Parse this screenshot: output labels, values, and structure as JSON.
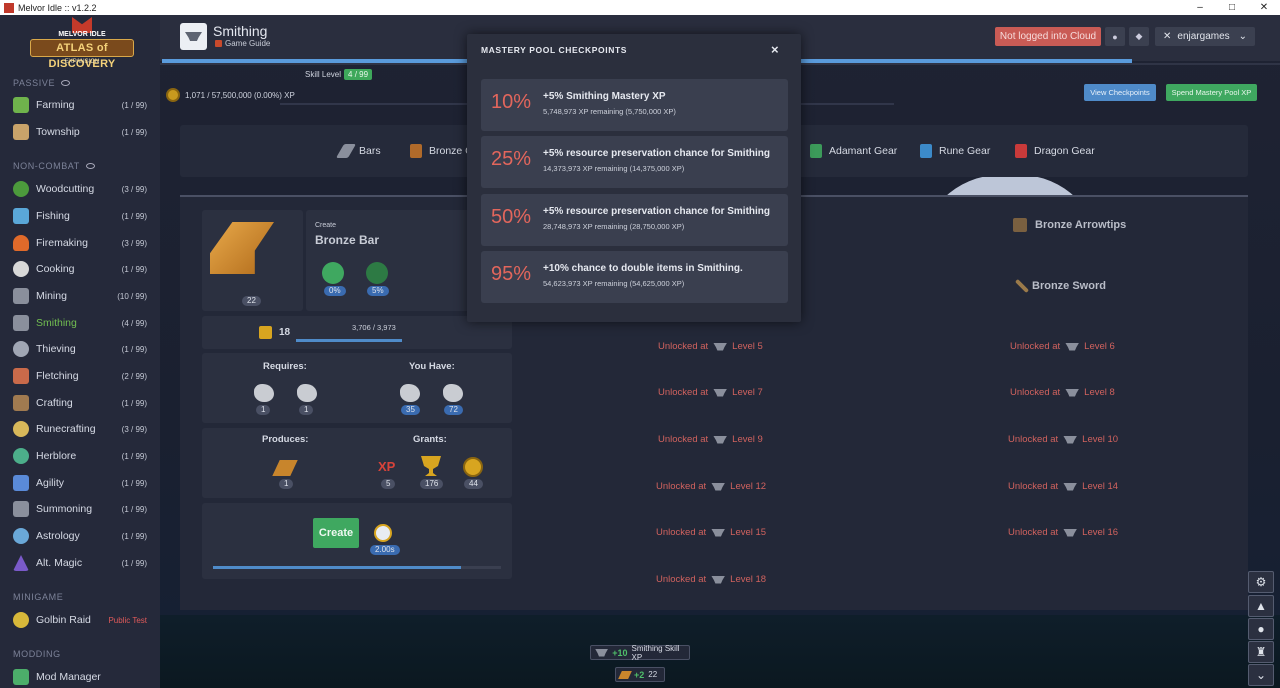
{
  "window": {
    "title": "Melvor Idle :: v1.2.2",
    "controls": [
      "–",
      "□",
      "✕"
    ]
  },
  "logo": {
    "top": "MELVOR IDLE",
    "main": "ATLAS of DISCOVERY",
    "sub": "EXPANSION"
  },
  "sidebar": {
    "sections": [
      {
        "label": "PASSIVE"
      },
      {
        "label": "NON-COMBAT"
      },
      {
        "label": "MINIGAME"
      },
      {
        "label": "MODDING"
      }
    ],
    "items": [
      {
        "label": "Farming",
        "level": "(1 / 99)",
        "color": "#6fb34c"
      },
      {
        "label": "Township",
        "level": "(1 / 99)",
        "color": "#c9a36a"
      },
      {
        "label": "Woodcutting",
        "level": "(3 / 99)",
        "color": "#4c9a3c"
      },
      {
        "label": "Fishing",
        "level": "(1 / 99)",
        "color": "#5aa7d8"
      },
      {
        "label": "Firemaking",
        "level": "(3 / 99)",
        "color": "#e06a2a"
      },
      {
        "label": "Cooking",
        "level": "(1 / 99)",
        "color": "#d8d8d8"
      },
      {
        "label": "Mining",
        "level": "(10 / 99)",
        "color": "#8a8f9c"
      },
      {
        "label": "Smithing",
        "level": "(4 / 99)",
        "color": "#8a8f9c"
      },
      {
        "label": "Thieving",
        "level": "(1 / 99)",
        "color": "#a0a6b4"
      },
      {
        "label": "Fletching",
        "level": "(2 / 99)",
        "color": "#c96a4a"
      },
      {
        "label": "Crafting",
        "level": "(1 / 99)",
        "color": "#a07a50"
      },
      {
        "label": "Runecrafting",
        "level": "(3 / 99)",
        "color": "#d8b85a"
      },
      {
        "label": "Herblore",
        "level": "(1 / 99)",
        "color": "#4cae8a"
      },
      {
        "label": "Agility",
        "level": "(1 / 99)",
        "color": "#5a8ad8"
      },
      {
        "label": "Summoning",
        "level": "(1 / 99)",
        "color": "#8a8f9c"
      },
      {
        "label": "Astrology",
        "level": "(1 / 99)",
        "color": "#6aa8d8"
      },
      {
        "label": "Alt. Magic",
        "level": "(1 / 99)",
        "color": "#7a5ac9"
      }
    ],
    "minigame": {
      "label": "Golbin Raid",
      "badge": "Public Test"
    },
    "modding": {
      "label": "Mod Manager"
    }
  },
  "header": {
    "title": "Smithing",
    "guide": "Game Guide",
    "cloud_btn": "Not logged into Cloud",
    "user": "enjargames",
    "skill_level_label": "Skill Level",
    "skill_level": "4 / 99",
    "mastery_xp": "1,071 / 57,500,000 (0.00%) XP",
    "view_checkpoints": "View Checkpoints",
    "spend_pool": "Spend Mastery Pool XP"
  },
  "categories": [
    "Bars",
    "Bronze Gear",
    "Adamant Gear",
    "Rune Gear",
    "Dragon Gear"
  ],
  "recipe": {
    "create_label": "Create",
    "name": "Bronze Bar",
    "qty": "22",
    "preserve": "0%",
    "double": "5%",
    "mastery_level": "18",
    "mastery_xp": "3,706 / 3,973",
    "mastery_progress": 0.93,
    "requires_label": "Requires:",
    "you_have_label": "You Have:",
    "requires": [
      "1",
      "1"
    ],
    "you_have": [
      "35",
      "72"
    ],
    "produces_label": "Produces:",
    "grants_label": "Grants:",
    "produces": [
      "1"
    ],
    "grants": [
      {
        "icon": "XP",
        "qty": "5"
      },
      {
        "qty": "176"
      },
      {
        "qty": "44"
      }
    ],
    "create_btn": "Create",
    "interval": "2.00s",
    "progress": 0.86
  },
  "recipes_right": [
    "Bronze Arrowtips",
    "Bronze Sword"
  ],
  "unlocks": {
    "prefix": "Unlocked at",
    "left": [
      "Level 5",
      "Level 7",
      "Level 9",
      "Level 12",
      "Level 15",
      "Level 18"
    ],
    "right": [
      "Level 6",
      "Level 8",
      "Level 10",
      "Level 14",
      "Level 16"
    ]
  },
  "toasts": {
    "xp_amount": "+10",
    "xp_label": "Smithing Skill XP",
    "item_amount": "+2",
    "item_qty": "22"
  },
  "modal": {
    "title": "MASTERY POOL CHECKPOINTS",
    "close": "×",
    "checkpoints": [
      {
        "pct": "10%",
        "desc": "+5% Smithing Mastery XP",
        "remaining": "5,748,973 XP remaining (5,750,000 XP)"
      },
      {
        "pct": "25%",
        "desc": "+5% resource preservation chance for Smithing",
        "remaining": "14,373,973 XP remaining (14,375,000 XP)"
      },
      {
        "pct": "50%",
        "desc": "+5% resource preservation chance for Smithing",
        "remaining": "28,748,973 XP remaining (28,750,000 XP)"
      },
      {
        "pct": "95%",
        "desc": "+10% chance to double items in Smithing.",
        "remaining": "54,623,973 XP remaining (54,625,000 XP)"
      }
    ]
  }
}
